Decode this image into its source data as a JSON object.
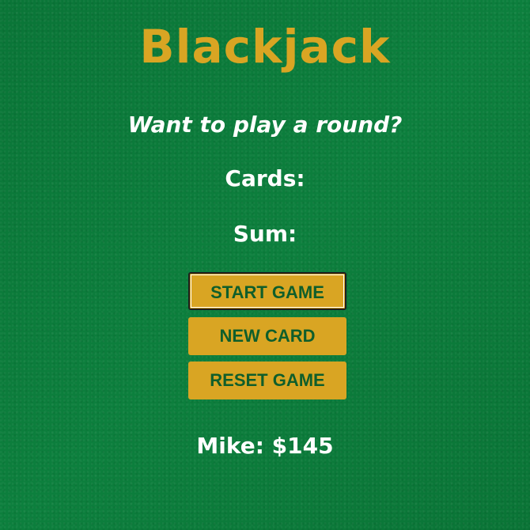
{
  "game": {
    "title": "Blackjack",
    "message": "Want to play a round?",
    "cards_label": "Cards:",
    "sum_label": "Sum:",
    "player_info": "Mike: $145"
  },
  "buttons": {
    "start": "START GAME",
    "new_card": "NEW CARD",
    "reset": "RESET GAME"
  },
  "colors": {
    "table_felt": "#0b7a3a",
    "title_gold": "#d9a523",
    "button_bg": "#d9a523",
    "button_text": "#0f5e2b",
    "text": "#ffffff"
  }
}
